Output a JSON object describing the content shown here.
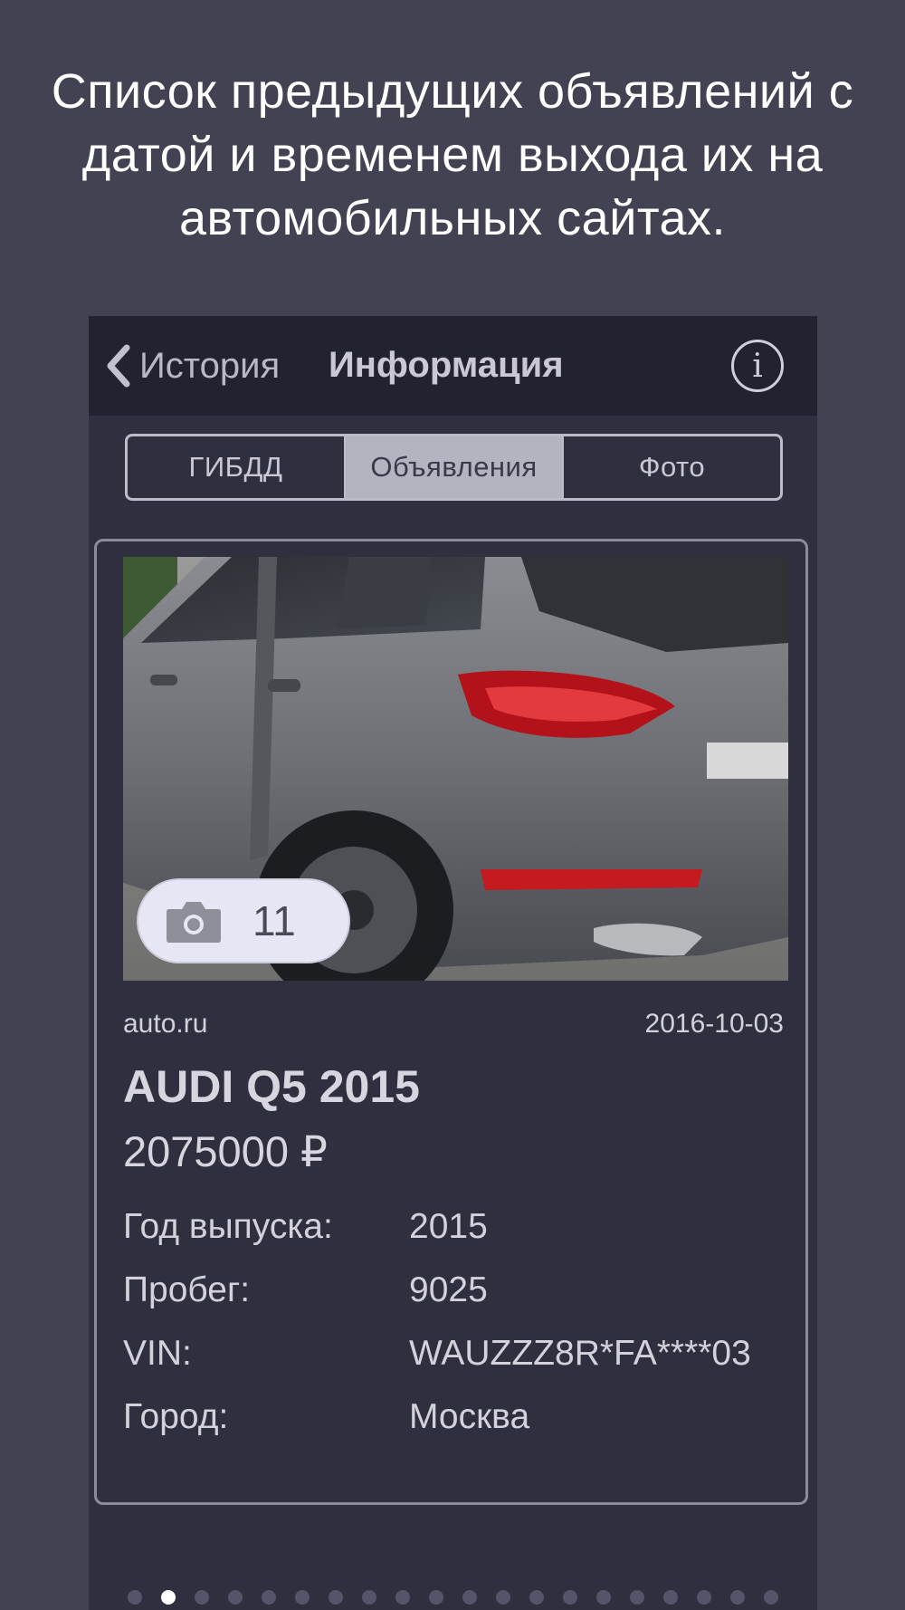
{
  "promo": {
    "text": "Список предыдущих объявлений с\nдатой и временем выхода их на\nавтомобильных сайтах."
  },
  "navbar": {
    "back_label": "История",
    "title": "Информация",
    "info_icon": "info-icon",
    "back_icon": "chevron-left-icon"
  },
  "tabs": [
    {
      "label": "ГИБДД",
      "active": false
    },
    {
      "label": "Объявления",
      "active": true
    },
    {
      "label": "Фото",
      "active": false
    }
  ],
  "listing": {
    "photo_count": "11",
    "camera_icon": "camera-icon",
    "source": "auto.ru",
    "date": "2016-10-03",
    "title": "AUDI Q5 2015",
    "price": "2075000 ₽",
    "specs": [
      {
        "key": "Год выпуска:",
        "value": "2015"
      },
      {
        "key": "Пробег:",
        "value": "9025"
      },
      {
        "key": "VIN:",
        "value": "WAUZZZ8R*FA****03"
      },
      {
        "key": "Город:",
        "value": "Москва"
      }
    ]
  },
  "pagination": {
    "count": 20,
    "active_index": 1
  },
  "colors": {
    "background": "#434252",
    "navbar": "#232230",
    "screen": "#302f3f",
    "active_segment": "#b4b3c0"
  }
}
